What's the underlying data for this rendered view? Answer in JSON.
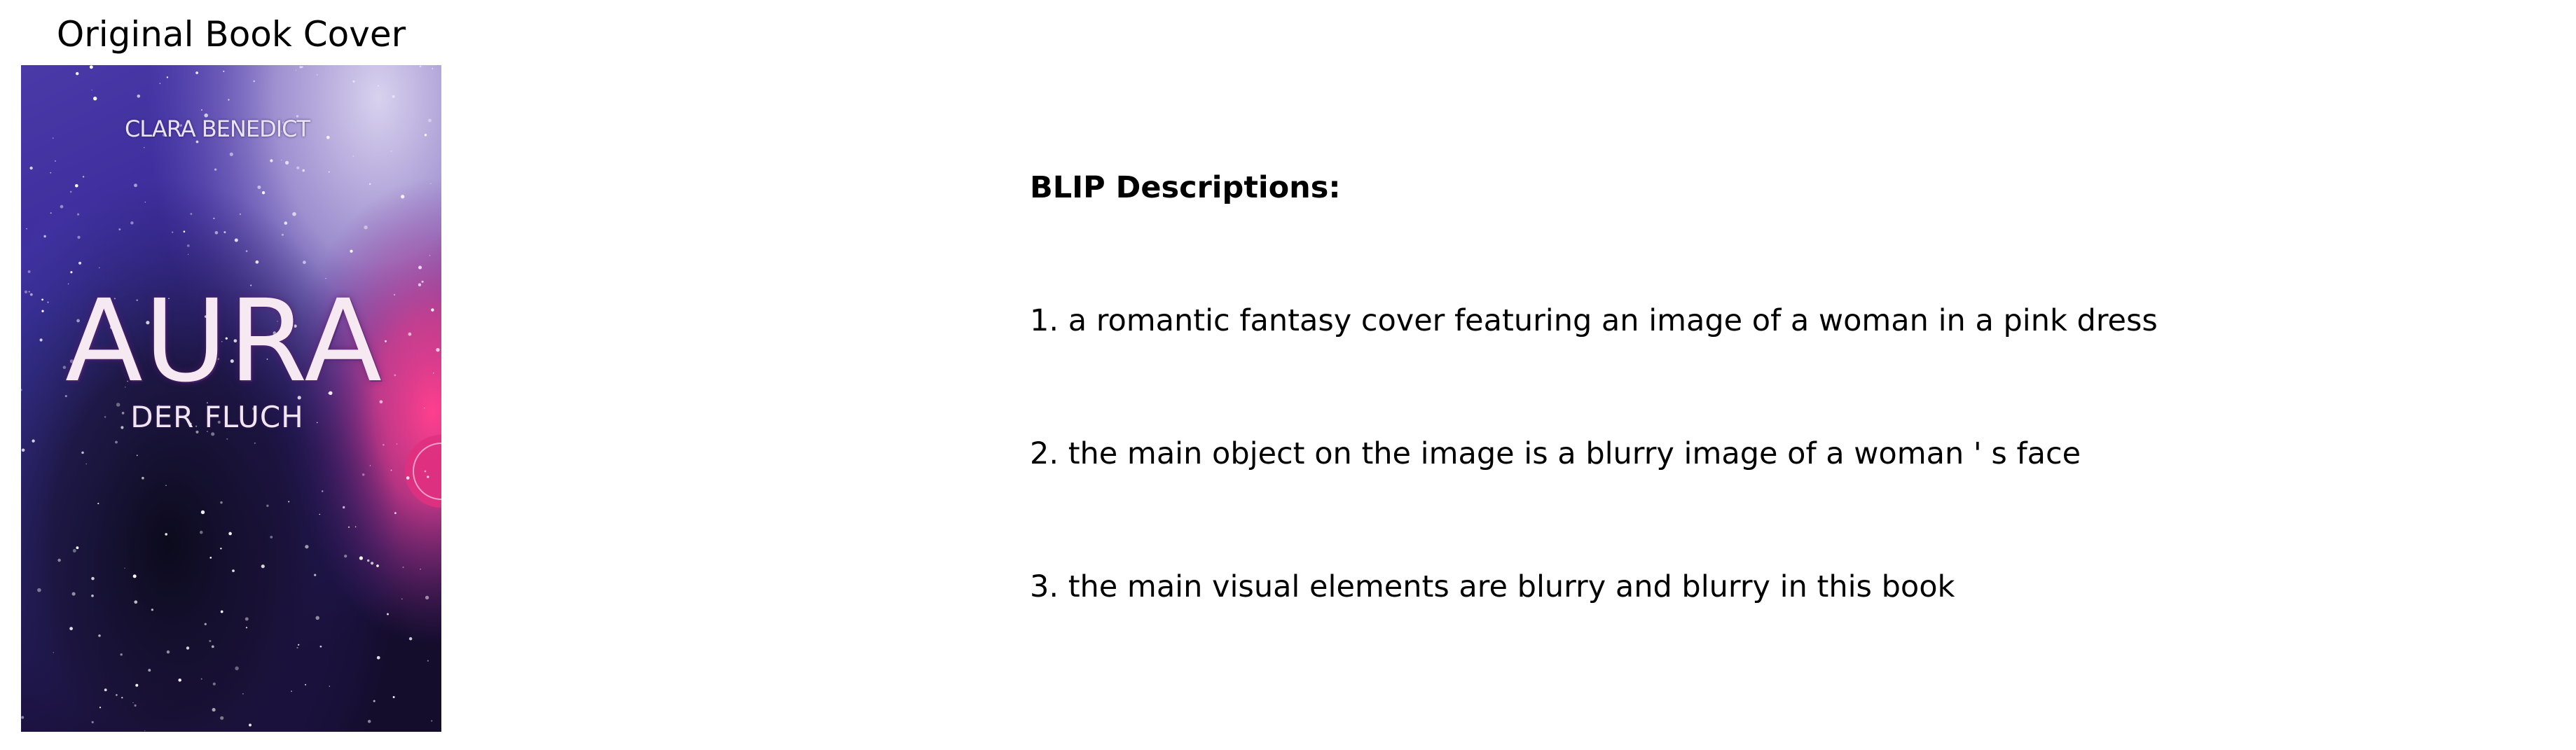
{
  "left_panel": {
    "title": "Original Book Cover",
    "cover": {
      "author": "CLARA BENEDICT",
      "title": "AURA",
      "subtitle": "DER FLUCH"
    }
  },
  "right_panel": {
    "heading": "BLIP Descriptions:",
    "descriptions": [
      "1. a romantic fantasy cover featuring an image of a woman in a pink dress",
      "2. the main object on the image is a blurry image of a woman ' s face",
      "3. the main visual elements are blurry and blurry in this book"
    ]
  }
}
